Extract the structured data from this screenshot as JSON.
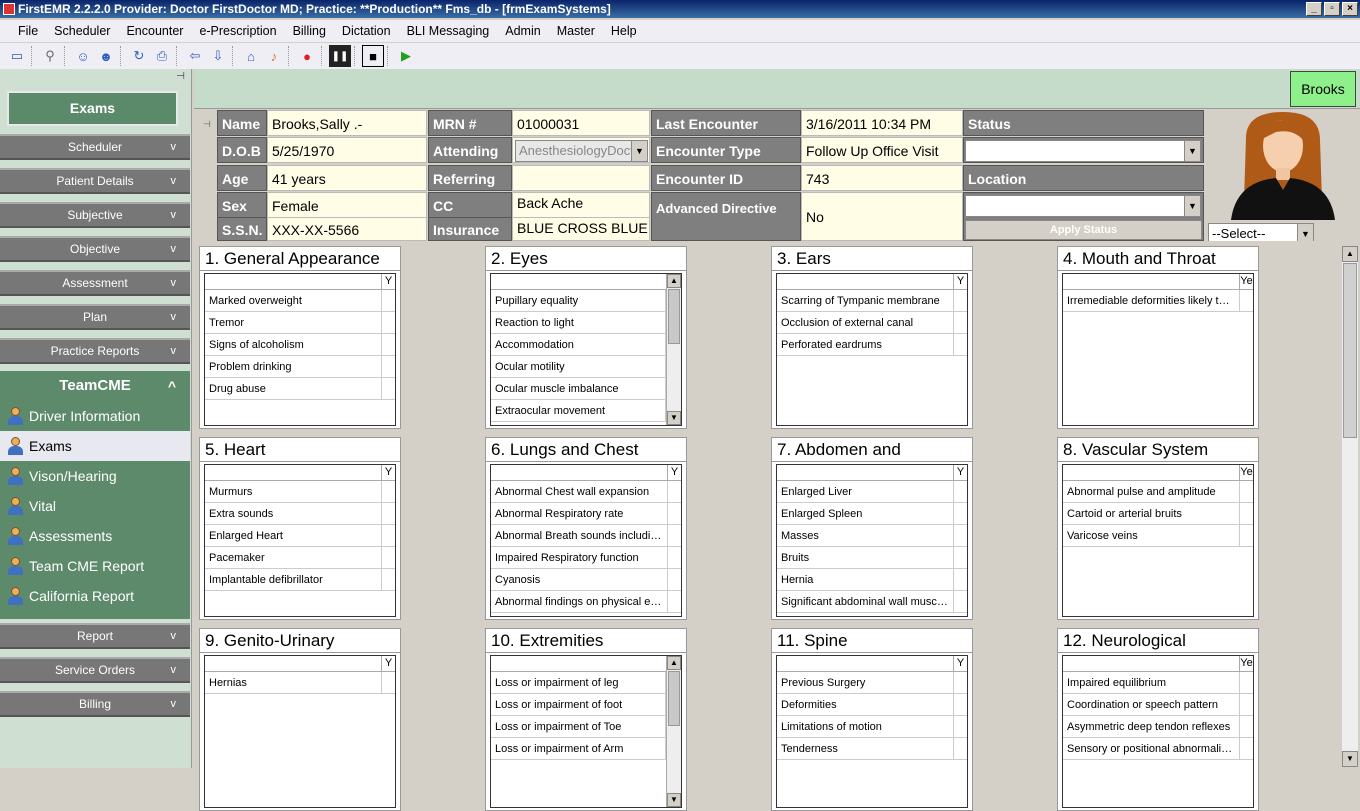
{
  "window": {
    "title": "FirstEMR 2.2.2.0 Provider: Doctor FirstDoctor MD; Practice: **Production** Fms_db - [frmExamSystems]",
    "min": "_",
    "max": "▫",
    "close": "×"
  },
  "menu": [
    "File",
    "Scheduler",
    "Encounter",
    "e-Prescription",
    "Billing",
    "Dictation",
    "BLI Messaging",
    "Admin",
    "Master",
    "Help"
  ],
  "sidebar": {
    "exams_button": "Exams",
    "sections_top": [
      {
        "label": "Scheduler",
        "chev": "v"
      },
      {
        "label": "Patient Details",
        "chev": "v"
      },
      {
        "label": "Subjective",
        "chev": "v"
      },
      {
        "label": "Objective",
        "chev": "v"
      },
      {
        "label": "Assessment",
        "chev": "v"
      },
      {
        "label": "Plan",
        "chev": "v"
      },
      {
        "label": "Practice Reports",
        "chev": "v"
      }
    ],
    "teamcme": {
      "label": "TeamCME",
      "chev": "^",
      "items": [
        "Driver Information",
        "Exams",
        "Vison/Hearing",
        "Vital",
        "Assessments",
        "Team CME Report",
        "California Report"
      ]
    },
    "sections_bottom": [
      {
        "label": "Report",
        "chev": "v"
      },
      {
        "label": "Service Orders",
        "chev": "v"
      },
      {
        "label": "Billing",
        "chev": "v"
      }
    ]
  },
  "patient": {
    "brooks_button": "Brooks",
    "name_label": "Name",
    "name": "Brooks,Sally .-",
    "dob_label": "D.O.B",
    "dob": "5/25/1970",
    "age_label": "Age",
    "age": "41 years",
    "sex_label": "Sex",
    "sex": "Female",
    "ssn_label": "S.S.N.",
    "ssn": "XXX-XX-5566",
    "mrn_label": "MRN #",
    "mrn": "01000031",
    "attending_label": "Attending",
    "attending": "AnesthesiologyDoct",
    "referring_label": "Referring",
    "referring": "",
    "cc_label": "CC",
    "cc": "Back Ache",
    "insurance_label": "Insurance",
    "insurance": "BLUE CROSS BLUE",
    "last_enc_label": "Last Encounter",
    "last_enc": "3/16/2011 10:34 PM",
    "enc_type_label": "Encounter Type",
    "enc_type": "Follow Up Office Visit",
    "enc_id_label": "Encounter ID",
    "enc_id": "743",
    "adv_dir_label": "Advanced Directive",
    "adv_dir": "No",
    "status_label": "Status",
    "status_value": "",
    "location_label": "Location",
    "location_value": "",
    "apply_status": "Apply Status",
    "select_placeholder": "--Select--"
  },
  "exam_cards": [
    {
      "title": "1. General Appearance",
      "y": "Y",
      "scroll": false,
      "items": [
        "Marked overweight",
        "Tremor",
        "Signs of alcoholism",
        "Problem drinking",
        "Drug abuse"
      ]
    },
    {
      "title": "2. Eyes",
      "y": "",
      "scroll": true,
      "items": [
        "Pupillary equality",
        "Reaction to light",
        "Accommodation",
        "Ocular motility",
        "Ocular muscle imbalance",
        "Extraocular movement"
      ]
    },
    {
      "title": "3. Ears",
      "y": "Y",
      "scroll": false,
      "items": [
        "Scarring of Tympanic membrane",
        "Occlusion of external canal",
        "Perforated eardrums"
      ]
    },
    {
      "title": "4. Mouth and Throat",
      "y": "Ye",
      "scroll": false,
      "items": [
        "Irremediable deformities likely to int..."
      ]
    },
    {
      "title": "5. Heart",
      "y": "Y",
      "scroll": false,
      "items": [
        "Murmurs",
        "Extra sounds",
        "Enlarged Heart",
        "Pacemaker",
        "Implantable defibrillator"
      ]
    },
    {
      "title": "6. Lungs and Chest",
      "y": "Y",
      "scroll": false,
      "items": [
        "Abnormal Chest wall expansion",
        "Abnormal Respiratory rate",
        "Abnormal Breath sounds including ...",
        "Impaired Respiratory function",
        "Cyanosis",
        "Abnormal findings on physical exa..."
      ]
    },
    {
      "title": "7. Abdomen and",
      "y": "Y",
      "scroll": false,
      "items": [
        "Enlarged Liver",
        "Enlarged Spleen",
        "Masses",
        "Bruits",
        "Hernia",
        "Significant abdominal wall muscle ..."
      ]
    },
    {
      "title": "8. Vascular System",
      "y": "Ye",
      "scroll": false,
      "items": [
        "Abnormal pulse and amplitude",
        "Cartoid or arterial bruits",
        "Varicose veins"
      ]
    },
    {
      "title": "9. Genito-Urinary",
      "y": "Y",
      "scroll": false,
      "items": [
        "Hernias"
      ]
    },
    {
      "title": "10. Extremities",
      "y": "",
      "scroll": true,
      "items": [
        "Loss or impairment of leg",
        "Loss or impairment of foot",
        "Loss or impairment of Toe",
        "Loss or impairment of Arm"
      ]
    },
    {
      "title": "11. Spine",
      "y": "Y",
      "scroll": false,
      "items": [
        "Previous Surgery",
        "Deformities",
        "Limitations of motion",
        "Tenderness"
      ]
    },
    {
      "title": "12. Neurological",
      "y": "Ye",
      "scroll": false,
      "items": [
        "Impaired equilibrium",
        "Coordination or speech pattern",
        "Asymmetric deep tendon reflexes",
        "Sensory or positional abnormalities"
      ]
    }
  ]
}
